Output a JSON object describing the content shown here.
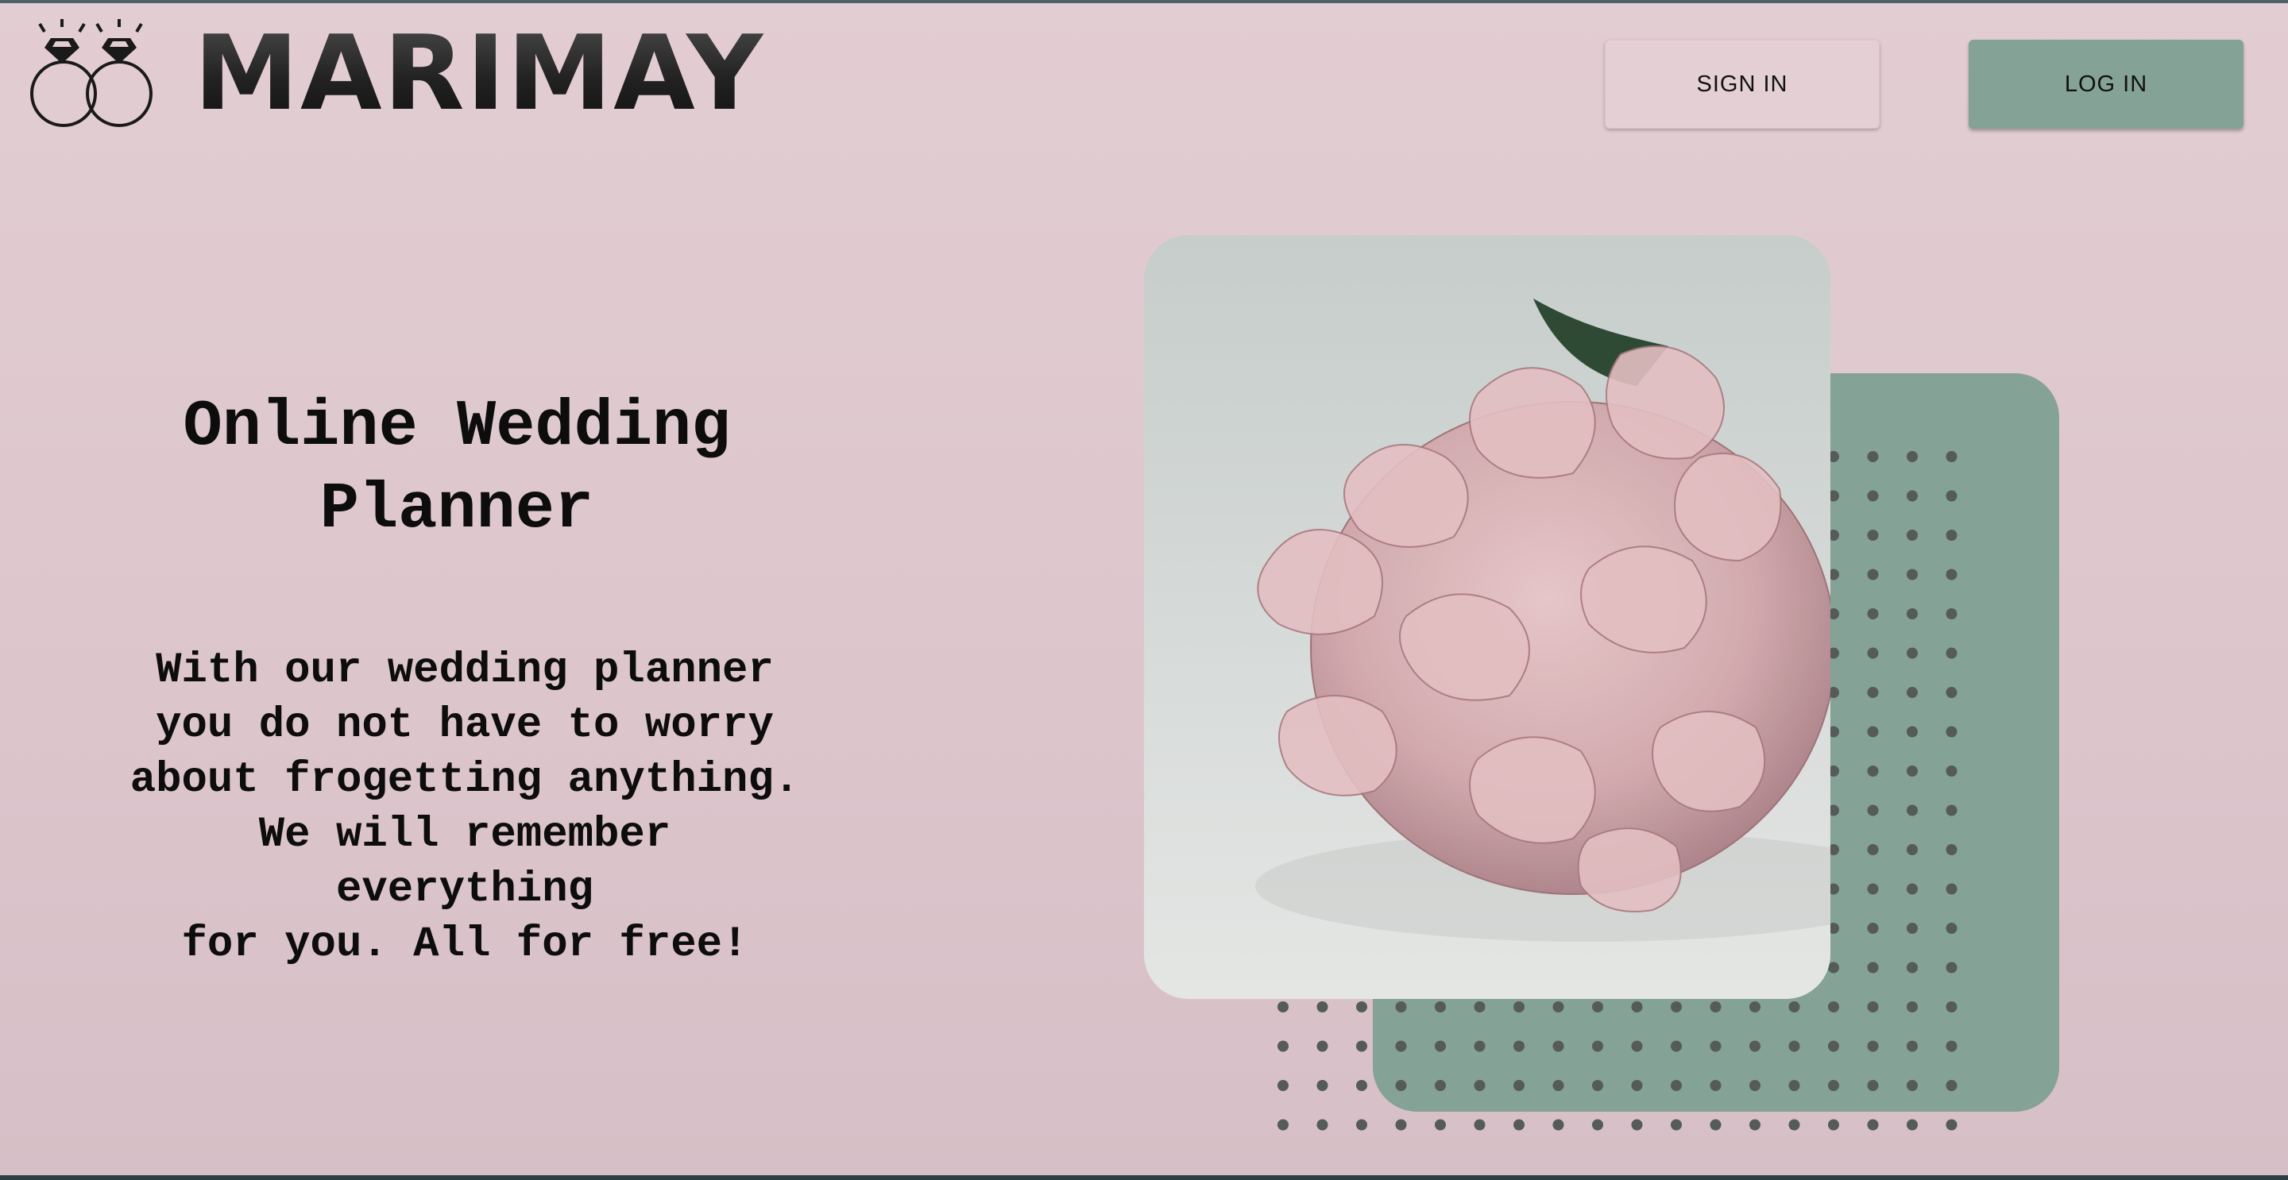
{
  "header": {
    "logo_icon": "wedding-rings-icon",
    "brand": "MARIMAY",
    "signin_label": "SIGN IN",
    "login_label": "LOG IN"
  },
  "hero": {
    "title_line1": "Online Wedding",
    "title_line2": "Planner",
    "text_lines": [
      "With our wedding planner",
      "you do not have to worry",
      "about frogetting anything.",
      "We will remember everything",
      "for you. All for free!"
    ]
  },
  "colors": {
    "background": "#dfc9cf",
    "accent_green": "#84a295",
    "text": "#0d0d0d"
  },
  "image": {
    "subject": "pink-hydrangea-bouquet"
  }
}
